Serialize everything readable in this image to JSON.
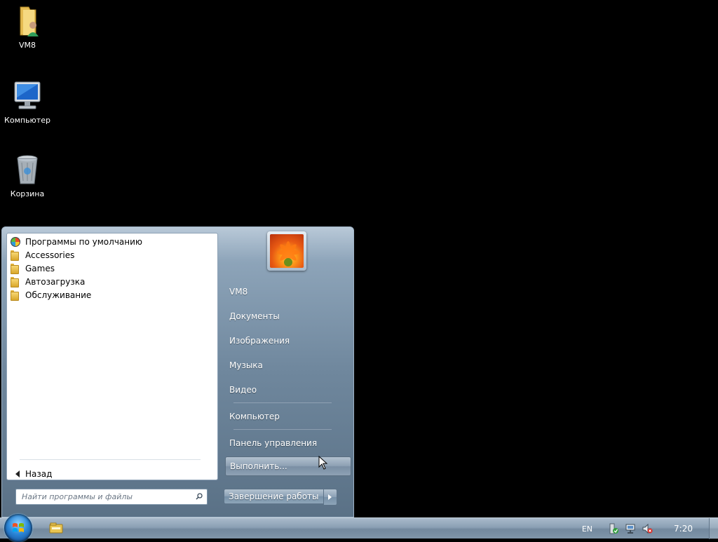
{
  "desktop": {
    "icons": [
      {
        "label": "VM8",
        "icon": "user-folder-icon"
      },
      {
        "label": "Компьютер",
        "icon": "computer-icon"
      },
      {
        "label": "Корзина",
        "icon": "recycle-bin-icon"
      }
    ]
  },
  "start_menu": {
    "programs": [
      {
        "label": "Программы по умолчанию",
        "icon": "default-programs-icon"
      },
      {
        "label": "Accessories",
        "icon": "folder-icon"
      },
      {
        "label": "Games",
        "icon": "folder-icon"
      },
      {
        "label": "Автозагрузка",
        "icon": "folder-icon"
      },
      {
        "label": "Обслуживание",
        "icon": "folder-icon"
      }
    ],
    "back_label": "Назад",
    "search_placeholder": "Найти программы и файлы",
    "right_items": {
      "user": "VM8",
      "documents": "Документы",
      "pictures": "Изображения",
      "music": "Музыка",
      "video": "Видео",
      "computer": "Компьютер",
      "control_panel": "Панель управления",
      "run": "Выполнить..."
    },
    "shutdown_label": "Завершение работы"
  },
  "taskbar": {
    "language": "EN",
    "clock": "7:20",
    "tray_icons": [
      "action-center-icon",
      "network-icon",
      "volume-muted-icon"
    ]
  },
  "colors": {
    "desktop_bg": "#000000",
    "menu_accent": "#6f879d"
  }
}
